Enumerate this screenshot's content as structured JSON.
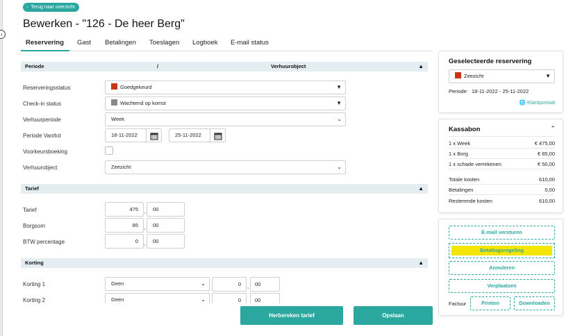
{
  "back_button": {
    "label": "Terug naar overzicht"
  },
  "page_title": "Bewerken - \"126 - De heer Berg\"",
  "tabs": [
    {
      "label": "Reservering",
      "active": true
    },
    {
      "label": "Gast"
    },
    {
      "label": "Betalingen"
    },
    {
      "label": "Toeslagen"
    },
    {
      "label": "Logboek"
    },
    {
      "label": "E-mail status"
    }
  ],
  "section_period": {
    "title": "Periode",
    "separator": "/",
    "right_title": "Verhuurobject"
  },
  "form": {
    "reservation_status": {
      "label": "Reserveringsstatus",
      "value": "Goedgekeurd",
      "color": "#c8361a"
    },
    "checkin_status": {
      "label": "Check-in status",
      "value": "Wachtend op komst",
      "color": "#888888"
    },
    "rental_period": {
      "label": "Verhuurperiode",
      "value": "Week"
    },
    "period_range": {
      "label": "Periode Van/tot",
      "from": "18-11-2022",
      "to": "25-11-2022"
    },
    "preferred_booking": {
      "label": "Voorkeursboeking",
      "checked": false
    },
    "rental_object": {
      "label": "Verhuurobject",
      "value": "Zeezicht"
    }
  },
  "section_tariff": {
    "title": "Tarief"
  },
  "tariff": {
    "rate": {
      "label": "Tarief",
      "whole": "475",
      "cents": "00"
    },
    "deposit": {
      "label": "Borgsom",
      "whole": "85",
      "cents": "00"
    },
    "vat": {
      "label": "BTW percentage",
      "whole": "0",
      "cents": "00"
    },
    "decimal_sep": ","
  },
  "section_discount": {
    "title": "Korting"
  },
  "discounts": [
    {
      "label": "Korting 1",
      "type": "Geen",
      "whole": "0",
      "cents": "00"
    },
    {
      "label": "Korting 2",
      "type": "Geen",
      "whole": "0",
      "cents": "00"
    }
  ],
  "actions": {
    "recalculate": "Herbereken tarief",
    "save": "Opslaan"
  },
  "selected_reservation": {
    "title": "Geselecteerde reservering",
    "object": "Zeezicht",
    "object_color": "#c8361a",
    "period_label": "Periode:",
    "period_value": "18-11-2022 - 25-11-2022",
    "portal_link": "Klantportaal"
  },
  "receipt": {
    "title": "Kassabon",
    "lines": [
      {
        "label": "1 x Week",
        "value": "€ 475,00"
      },
      {
        "label": "1 x Borg",
        "value": "€ 85,00"
      },
      {
        "label": "1 x schade verrekenen",
        "value": "€ 50,00"
      }
    ],
    "totals": [
      {
        "label": "Totale kosten",
        "value": "610,00"
      },
      {
        "label": "Betalingen",
        "value": "0,00"
      },
      {
        "label": "Resterende kosten",
        "value": "610,00"
      }
    ]
  },
  "side_actions": {
    "send_email": "E-mail versturen",
    "payment_plan": "Betalingsregeling",
    "cancel": "Annuleren",
    "move": "Verplaatsen",
    "invoice_label": "Factuur",
    "print": "Printen",
    "download": "Downloaden"
  },
  "colors": {
    "accent": "#2aa8a0",
    "highlight": "#f5e600",
    "section_bg": "#e4eef2"
  }
}
